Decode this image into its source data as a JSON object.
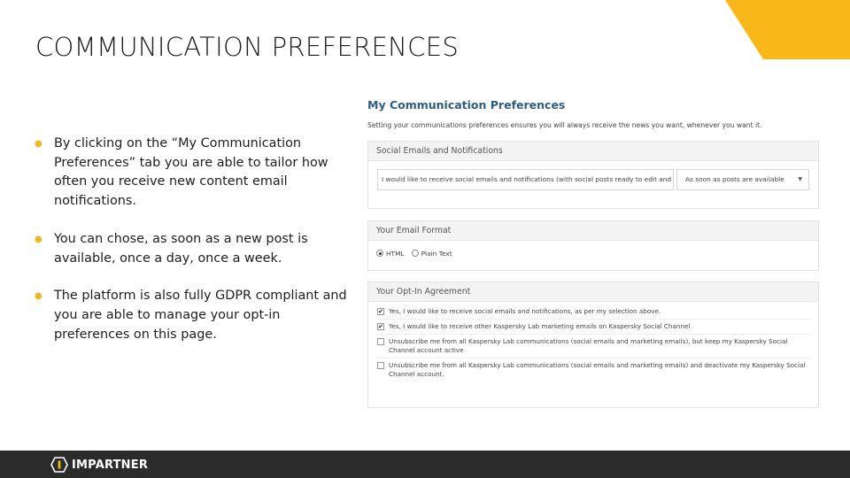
{
  "slide": {
    "title": "COMMUNICATION PREFERENCES"
  },
  "bullets": [
    "By clicking on the “My Communication Preferences” tab you are able to tailor how often you receive new content email notifications.",
    "You can chose, as soon as a new post is available, once a day, once a week.",
    "The platform is also fully GDPR compliant and you are able to manage your opt-in preferences on this page."
  ],
  "panel": {
    "title": "My Communication Preferences",
    "intro": "Setting your communications preferences ensures you will always receive the news you want, whenever you want it.",
    "social": {
      "header": "Social Emails and Notifications",
      "row_text": "I would like to receive social emails and notifications (with social posts ready to edit and share).",
      "select_value": "As soon as posts are available"
    },
    "format": {
      "header": "Your Email Format",
      "options": [
        "HTML",
        "Plain Text"
      ],
      "selected": "HTML"
    },
    "optin": {
      "header": "Your Opt-In Agreement",
      "items": [
        {
          "text": "Yes, I would like to receive social emails and notifications, as per my selection above.",
          "checked": true
        },
        {
          "text": "Yes, I would like to receive other Kaspersky Lab marketing emails on Kaspersky Social Channel",
          "checked": true
        },
        {
          "text": "Unsubscribe me from all Kaspersky Lab communications (social emails and marketing emails), but keep my Kaspersky Social Channel account active",
          "checked": false
        },
        {
          "text": "Unsubscribe me from all Kaspersky Lab communications (social emails and marketing emails) and deactivate my Kaspersky Social Channel account.",
          "checked": false
        }
      ]
    }
  },
  "footer": {
    "logo_text": "IMPARTNER"
  },
  "colors": {
    "accent": "#f2b51d",
    "panel_title": "#2f5d86",
    "footer_bg": "#2b2b2b"
  },
  "icons": {
    "bullet": "bullet-dot-icon",
    "logo": "impartner-logo-icon",
    "select": "chevron-down-icon"
  }
}
